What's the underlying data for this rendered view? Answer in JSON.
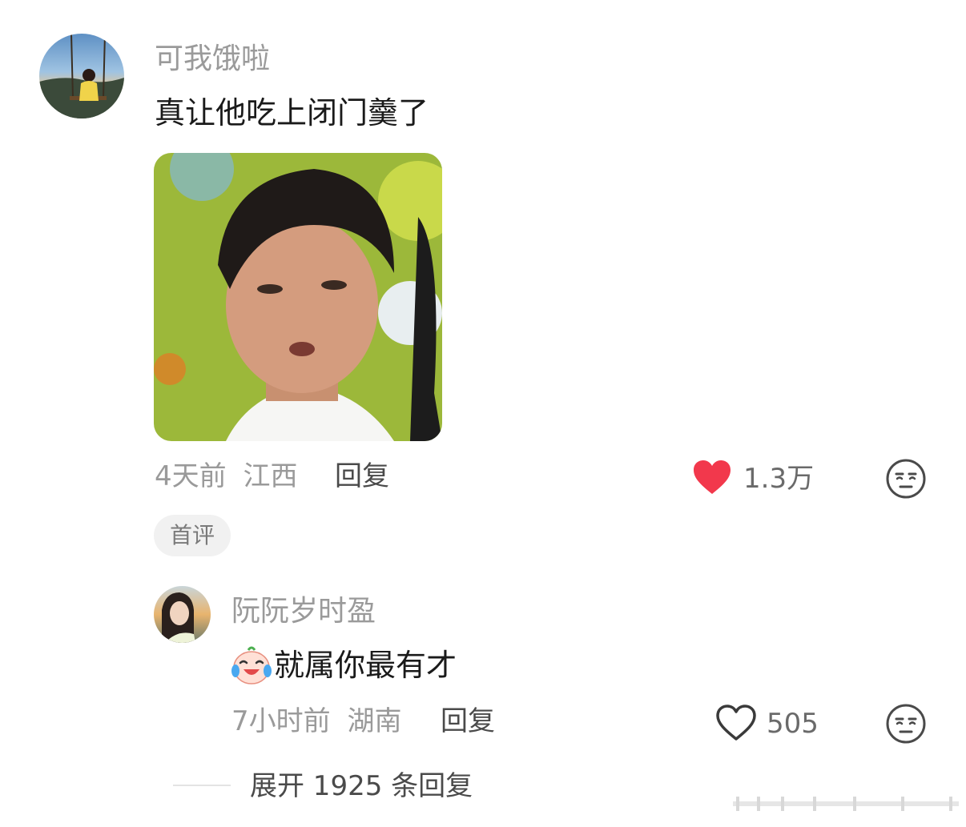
{
  "main_comment": {
    "username": "可我饿啦",
    "text": "真让他吃上闭门羹了",
    "time": "4天前",
    "location": "江西",
    "reply_label": "回复",
    "like_count": "1.3万",
    "liked": true,
    "badge": "首评"
  },
  "reply_comment": {
    "username": "阮阮岁时盈",
    "text": "就属你最有才",
    "time": "7小时前",
    "location": "湖南",
    "reply_label": "回复",
    "like_count": "505",
    "liked": false
  },
  "expand": {
    "label": "展开 1925 条回复"
  },
  "colors": {
    "like_red": "#f2384c",
    "secondary_text": "#9a9a9a",
    "primary_text": "#1a1a1a"
  },
  "icons": {
    "like_filled": "heart-filled-icon",
    "like_outline": "heart-outline-icon",
    "dislike": "unamused-face-icon",
    "emoji": "crying-laughing-face-icon"
  }
}
